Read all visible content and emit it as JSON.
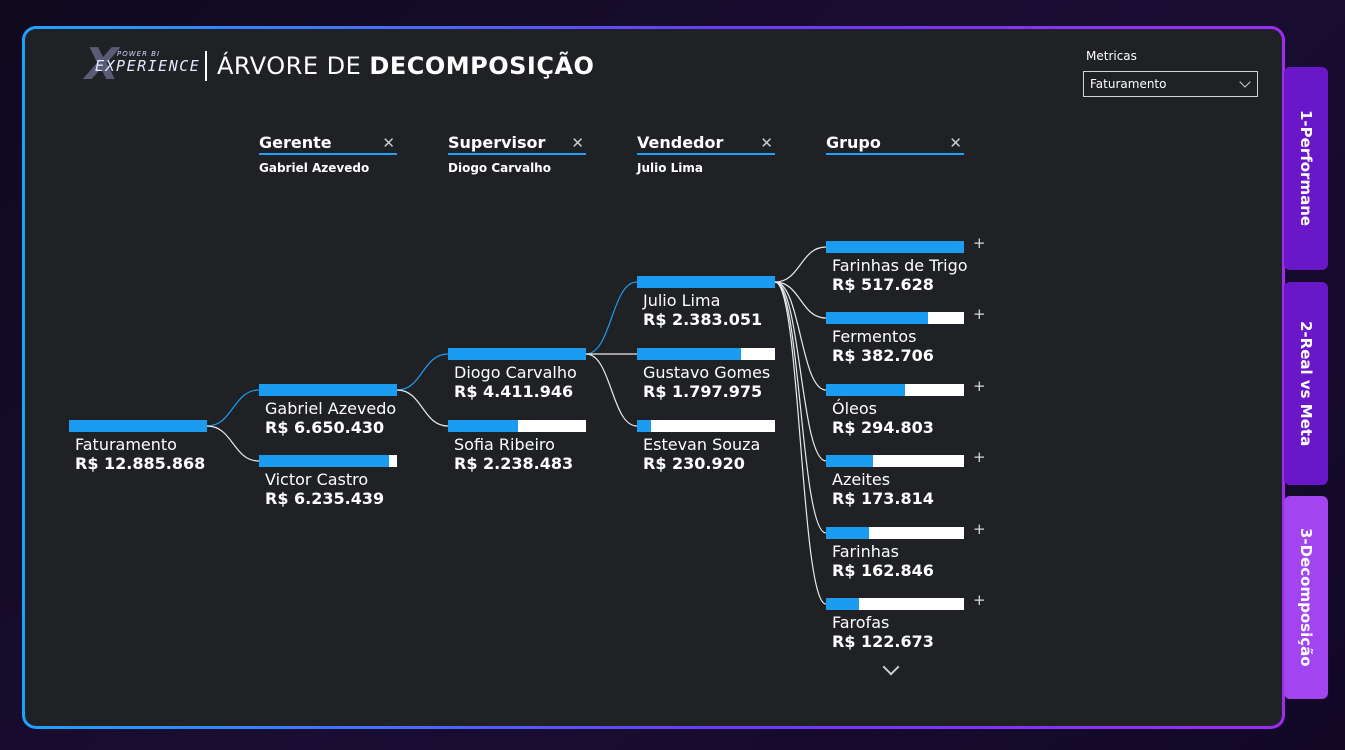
{
  "header": {
    "logo_small": "POWER BI",
    "logo_main": "EXPERIENCE",
    "title_light": "ÁRVORE DE ",
    "title_bold": "DECOMPOSIÇÃO"
  },
  "filter": {
    "label": "Metricas",
    "value": "Faturamento"
  },
  "levels": [
    {
      "name": "Gerente",
      "selected": "Gabriel Azevedo"
    },
    {
      "name": "Supervisor",
      "selected": "Diogo Carvalho"
    },
    {
      "name": "Vendedor",
      "selected": "Julio Lima"
    },
    {
      "name": "Grupo",
      "selected": ""
    }
  ],
  "root": {
    "label": "Faturamento",
    "value": "R$ 12.885.868",
    "fraction": 1.0
  },
  "gerentes": [
    {
      "label": "Gabriel Azevedo",
      "value": "R$ 6.650.430",
      "fraction": 1.0
    },
    {
      "label": "Victor Castro",
      "value": "R$ 6.235.439",
      "fraction": 0.94
    }
  ],
  "supervisores": [
    {
      "label": "Diogo Carvalho",
      "value": "R$ 4.411.946",
      "fraction": 1.0
    },
    {
      "label": "Sofia Ribeiro",
      "value": "R$ 2.238.483",
      "fraction": 0.51
    }
  ],
  "vendedores": [
    {
      "label": "Julio Lima",
      "value": "R$ 2.383.051",
      "fraction": 1.0
    },
    {
      "label": "Gustavo Gomes",
      "value": "R$ 1.797.975",
      "fraction": 0.75
    },
    {
      "label": "Estevan Souza",
      "value": "R$ 230.920",
      "fraction": 0.1
    }
  ],
  "grupos": [
    {
      "label": "Farinhas de Trigo",
      "value": "R$ 517.628",
      "fraction": 1.0
    },
    {
      "label": "Fermentos",
      "value": "R$ 382.706",
      "fraction": 0.74
    },
    {
      "label": "Óleos",
      "value": "R$ 294.803",
      "fraction": 0.57
    },
    {
      "label": "Azeites",
      "value": "R$ 173.814",
      "fraction": 0.34
    },
    {
      "label": "Farinhas",
      "value": "R$ 162.846",
      "fraction": 0.31
    },
    {
      "label": "Farofas",
      "value": "R$ 122.673",
      "fraction": 0.24
    }
  ],
  "tabs": [
    "1-Performane",
    "2-Real vs Meta",
    "3-Decomposição"
  ],
  "colors": {
    "accent": "#1b9cf0",
    "background": "#1f2125",
    "tab": "#6a16c9",
    "tab_active": "#a244f0"
  }
}
